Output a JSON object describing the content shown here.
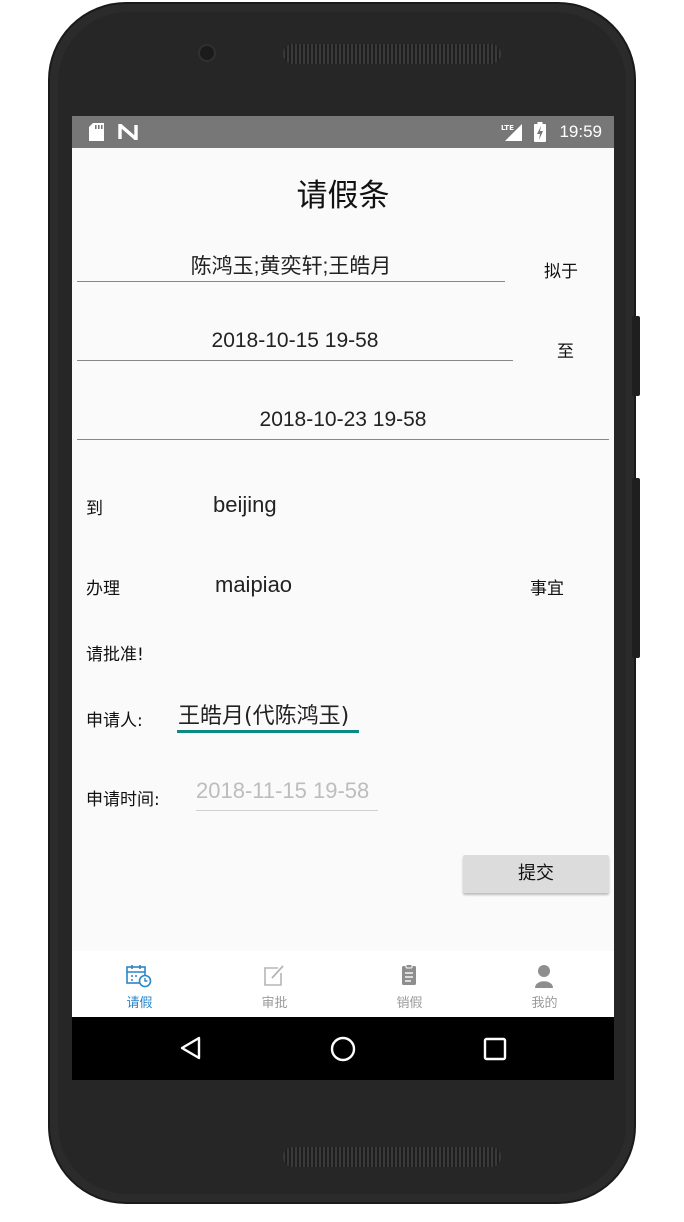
{
  "status_bar": {
    "time": "19:59",
    "network": "LTE"
  },
  "page": {
    "title": "请假条"
  },
  "form": {
    "names": "陈鸿玉;黄奕轩;王皓月",
    "intend_label": "拟于",
    "start_time": "2018-10-15 19-58",
    "to_label": "至",
    "end_time": "2018-10-23 19-58",
    "destination_label": "到",
    "destination": "beijing",
    "handle_label": "办理",
    "matter": "maipiao",
    "matter_suffix": "事宜",
    "approve_text": "请批准!",
    "applicant_label": "申请人:",
    "applicant": "王皓月(代陈鸿玉)",
    "apply_time_label": "申请时间:",
    "apply_time_placeholder": "2018-11-15 19-58",
    "submit_label": "提交"
  },
  "tabs": [
    {
      "label": "请假",
      "icon": "calendar-clock-icon",
      "active": true
    },
    {
      "label": "审批",
      "icon": "edit-icon",
      "active": false
    },
    {
      "label": "销假",
      "icon": "clipboard-icon",
      "active": false
    },
    {
      "label": "我的",
      "icon": "person-icon",
      "active": false
    }
  ],
  "colors": {
    "accent": "#0a8a80",
    "tab_active": "#2a86c9",
    "status_bar": "#777777"
  }
}
